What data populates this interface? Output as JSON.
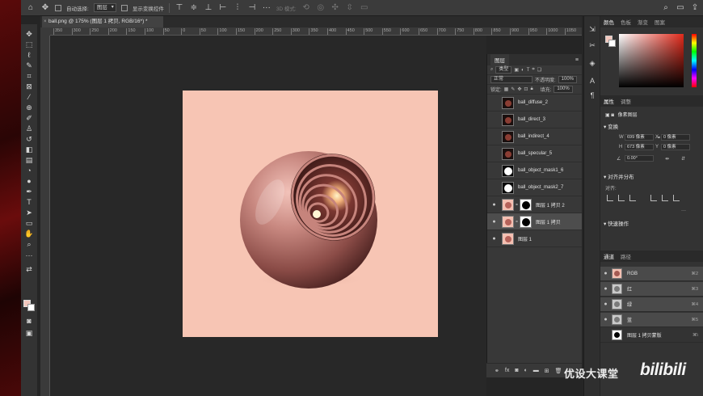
{
  "optionsbar": {
    "auto_select_label": "自动选择:",
    "auto_select_value": "图层",
    "show_transform_label": "显示变换控件",
    "mode_label": "3D 模式:"
  },
  "document": {
    "tab_title": "ball.png @ 175% (图层 1 拷贝, RGB/16*) *"
  },
  "ruler": {
    "ticks": [
      "350",
      "300",
      "250",
      "200",
      "150",
      "100",
      "50",
      "0",
      "50",
      "100",
      "150",
      "200",
      "250",
      "300",
      "350",
      "400",
      "450",
      "500",
      "550",
      "600",
      "650",
      "700",
      "750",
      "800",
      "850",
      "900",
      "950",
      "1000",
      "1050"
    ]
  },
  "layers_panel": {
    "tab": "图层",
    "kind_filter": "类型",
    "blend_mode": "正常",
    "opacity_label": "不透明度:",
    "opacity_value": "100%",
    "lock_label": "锁定:",
    "fill_label": "填充:",
    "fill_value": "100%",
    "layers": [
      {
        "name": "ball_diffuse_2",
        "visible": false,
        "thumb": "dark"
      },
      {
        "name": "ball_direct_3",
        "visible": false,
        "thumb": "dark"
      },
      {
        "name": "ball_indirect_4",
        "visible": false,
        "thumb": "dark"
      },
      {
        "name": "ball_specular_5",
        "visible": false,
        "thumb": "dark"
      },
      {
        "name": "ball_object_mask1_6",
        "visible": false,
        "thumb": "mask"
      },
      {
        "name": "ball_object_mask2_7",
        "visible": false,
        "thumb": "mask"
      },
      {
        "name": "图层 1 拷贝 2",
        "visible": true,
        "thumb": "pink",
        "has_mask": true
      },
      {
        "name": "图层 1 拷贝",
        "visible": true,
        "thumb": "pink",
        "has_mask": true,
        "selected": true
      },
      {
        "name": "图层 1",
        "visible": true,
        "thumb": "pink"
      }
    ]
  },
  "right_panels": {
    "color_tabs": [
      "颜色",
      "色板",
      "渐变",
      "图案"
    ],
    "props_tabs": [
      "属性",
      "调整"
    ],
    "pixel_layer_label": "像素图层",
    "transform_label": "变换",
    "w_label": "W",
    "w_value": "699 像素",
    "h_label": "H",
    "h_value": "673 像素",
    "x_label": "X",
    "x_value": "0 像素",
    "y_label": "Y",
    "y_value": "0 像素",
    "angle_value": "0.00°",
    "align_label": "对齐并分布",
    "align_sub": "对齐:",
    "quick_label": "快速操作",
    "channel_tabs": [
      "通道",
      "路径"
    ],
    "channels": [
      {
        "name": "RGB",
        "key": "⌘2",
        "thumb": "rgb",
        "visible": true
      },
      {
        "name": "红",
        "key": "⌘3",
        "thumb": "gray",
        "visible": true
      },
      {
        "name": "绿",
        "key": "⌘4",
        "thumb": "gray",
        "visible": true
      },
      {
        "name": "蓝",
        "key": "⌘5",
        "thumb": "gray",
        "visible": true
      },
      {
        "name": "图层 1 拷贝蒙版",
        "key": "⌘\\",
        "thumb": "blk",
        "visible": false
      }
    ]
  },
  "watermark": {
    "text": "优设大课堂",
    "logo": "bilibili"
  },
  "colors": {
    "foreground": "#f3c7bd",
    "background": "#ffffff",
    "artboard": "#f7c5b4"
  }
}
